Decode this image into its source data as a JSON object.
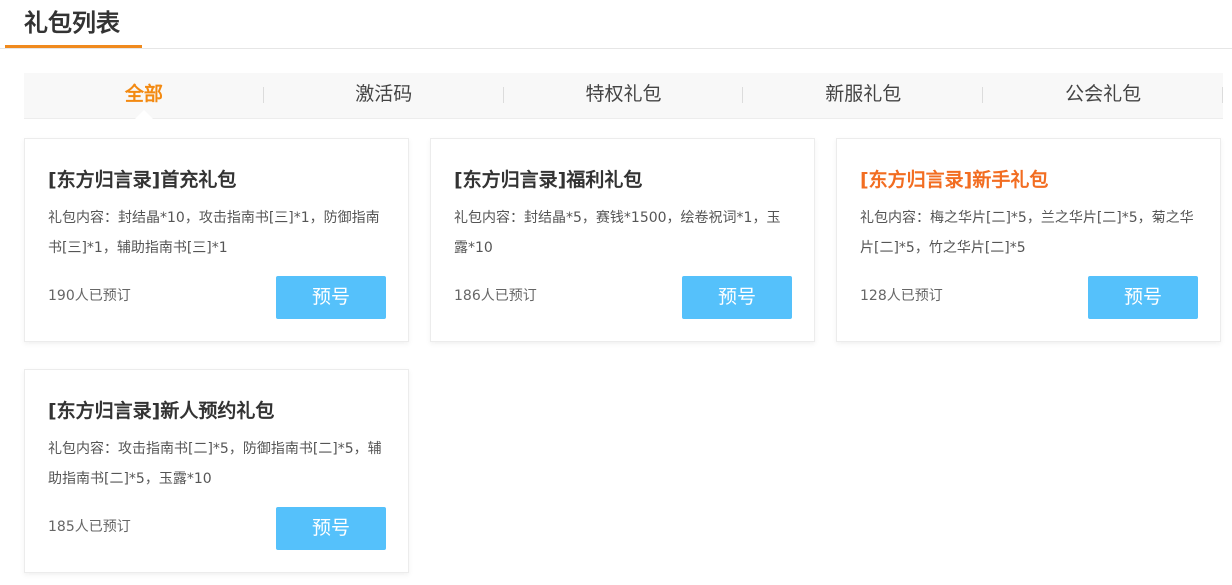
{
  "page": {
    "title": "礼包列表"
  },
  "tabs": [
    {
      "label": "全部",
      "active": true
    },
    {
      "label": "激活码",
      "active": false
    },
    {
      "label": "特权礼包",
      "active": false
    },
    {
      "label": "新服礼包",
      "active": false
    },
    {
      "label": "公会礼包",
      "active": false
    }
  ],
  "colors": {
    "accent": "#f38a12",
    "title_highlight": "#f26d21",
    "button": "#55c1fb"
  },
  "cards": [
    {
      "title": "[东方归言录]首充礼包",
      "content": "礼包内容：封结晶*10，攻击指南书[三]*1，防御指南书[三]*1，辅助指南书[三]*1",
      "count": "190人已预订",
      "button": "预号",
      "highlight": false
    },
    {
      "title": "[东方归言录]福利礼包",
      "content": "礼包内容：封结晶*5，赛钱*1500，绘卷祝词*1，玉露*10",
      "count": "186人已预订",
      "button": "预号",
      "highlight": false
    },
    {
      "title": "[东方归言录]新手礼包",
      "content": "礼包内容：梅之华片[二]*5，兰之华片[二]*5，菊之华片[二]*5，竹之华片[二]*5",
      "count": "128人已预订",
      "button": "预号",
      "highlight": true
    },
    {
      "title": "[东方归言录]新人预约礼包",
      "content": "礼包内容：攻击指南书[二]*5，防御指南书[二]*5，辅助指南书[二]*5，玉露*10",
      "count": "185人已预订",
      "button": "预号",
      "highlight": false
    }
  ]
}
